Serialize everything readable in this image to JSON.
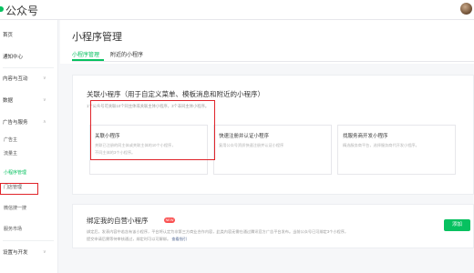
{
  "brand": {
    "title": "公众号"
  },
  "sidebar": {
    "items": [
      {
        "label": "首页"
      },
      {
        "label": "通知中心"
      },
      {
        "label": "内容与互动",
        "chevron": "∨"
      },
      {
        "label": "数据",
        "chevron": "∨"
      },
      {
        "label": "广告与服务",
        "chevron": "∧"
      },
      {
        "label": "广告主"
      },
      {
        "label": "流量主"
      },
      {
        "label": "小程序管理"
      },
      {
        "label": "门店管理"
      },
      {
        "label": "微信搜一搜"
      },
      {
        "label": "服务市场"
      },
      {
        "label": "设置与开发",
        "chevron": "∨"
      }
    ]
  },
  "page": {
    "title": "小程序管理",
    "tabs": [
      {
        "label": "小程序管理"
      },
      {
        "label": "附近的小程序"
      }
    ]
  },
  "link_section": {
    "title": "关联小程序（用于自定义菜单、模板消息和附近的小程序）",
    "desc": "1个公众号可关联10个同主体或关联主体小程序，3个非同主体小程序。",
    "options": [
      {
        "title": "关联小程序",
        "line1": "关联已注册的同主体或关联主体的10个小程序，",
        "line2": "不同主体的3个小程序。"
      },
      {
        "title": "快速注册并认证小程序",
        "line1": "复用公众号资质快速注册并认证小程序",
        "line2": ""
      },
      {
        "title": "找服务商开发小程序",
        "line1": "精选服务商平台，选择服务商代开发小程序。",
        "line2": ""
      }
    ]
  },
  "bind_section": {
    "title": "绑定我的自营小程序",
    "badge": "NEW",
    "desc1": "绑定后，发表内容中若含有该小程序，平台将认定为非第三方商业合作内容，此类内容无需在通过腾讯官方广告平台发布。当前公众号已可绑定3个小程序，",
    "desc2": "提交申请后需等待审核通过，绑定时可以可解绑。",
    "link": "查看指引",
    "button": "添加"
  },
  "colors": {
    "accent": "#07c160",
    "highlight_border": "#e0242a",
    "badge": "#fa5151",
    "link": "#576b95"
  }
}
